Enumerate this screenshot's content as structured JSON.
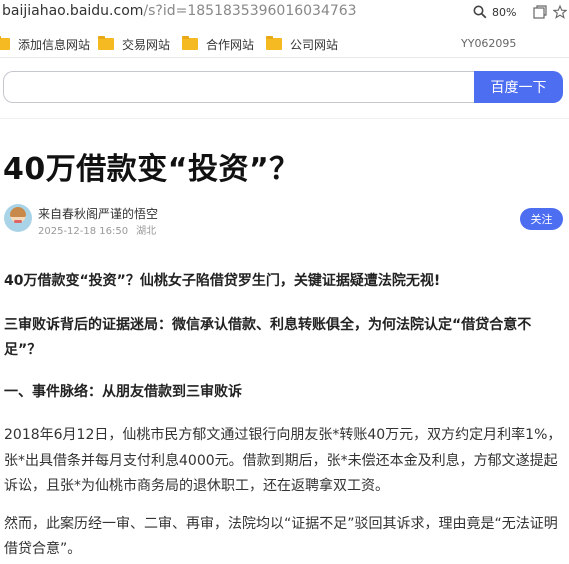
{
  "browser": {
    "url_host": "baijiahao.baidu.com",
    "url_rest": "/s?id=1851835396016034763",
    "zoom": "80%",
    "icons": [
      "magnifier-icon",
      "tabs-icon",
      "star-icon"
    ]
  },
  "bookmarks": {
    "items": [
      {
        "label": "添加信息网站"
      },
      {
        "label": "交易网站"
      },
      {
        "label": "合作网站"
      },
      {
        "label": "公司网站"
      }
    ],
    "id_text": "YY062095"
  },
  "search": {
    "placeholder": "",
    "button_label": "百度一下"
  },
  "article": {
    "title": "40万借款变“投资”？",
    "author": "来自春秋阁严谨的悟空",
    "date": "2025-12-18 16:50",
    "location": "湖北",
    "follow_label": "关注",
    "paragraphs": [
      "40万借款变“投资”？仙桃女子陷借贷罗生门，关键证据疑遭法院无视!",
      "三审败诉背后的证据迷局：微信承认借款、利息转账俱全，为何法院认定“借贷合意不足”？",
      "一、事件脉络：从朋友借款到三审败诉",
      "2018年6月12日，仙桃市民方郁文通过银行向朋友张*转账40万元，双方约定月利率1%，张*出具借条并每月支付利息4000元。借款到期后，张*未偿还本金及利息，方郁文遂提起诉讼，且张*为仙桃市商务局的退休职工，还在返聘拿双工资。",
      "然而，此案历经一审、二审、再审，法院均以“证据不足”驳回其诉求，理由竟是“无法证明借贷合意”。"
    ]
  },
  "colors": {
    "accent": "#4e6ef2",
    "folder": "#f5b921"
  }
}
